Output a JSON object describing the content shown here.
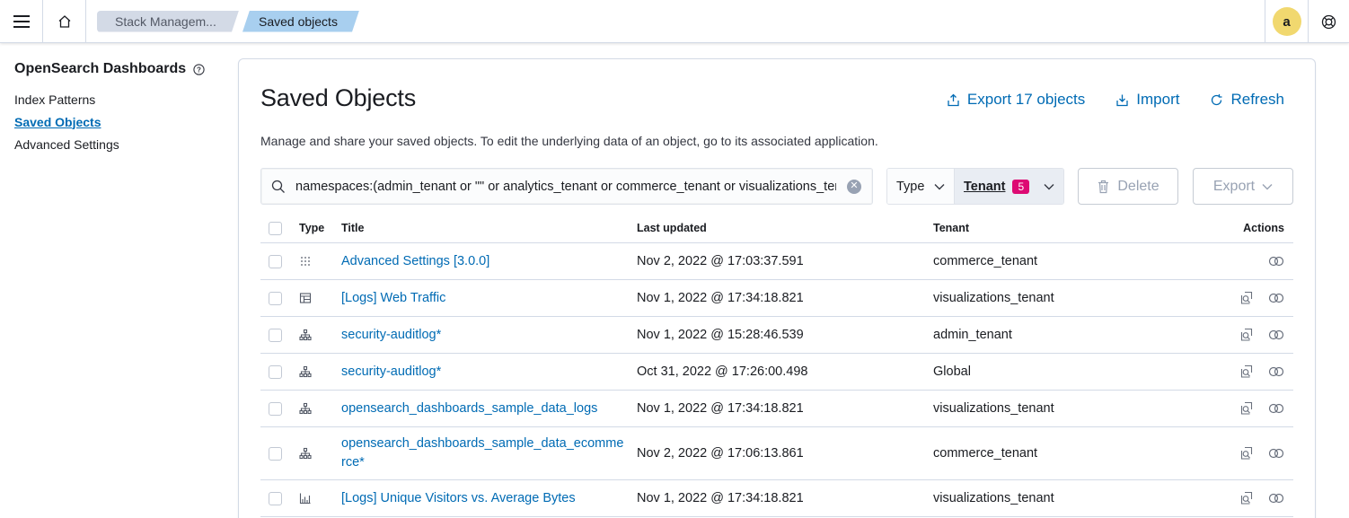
{
  "header": {
    "breadcrumbs": [
      "Stack Managem...",
      "Saved objects"
    ],
    "avatar_initial": "a"
  },
  "sidebar": {
    "title": "OpenSearch Dashboards",
    "items": [
      {
        "label": "Index Patterns",
        "active": false
      },
      {
        "label": "Saved Objects",
        "active": true
      },
      {
        "label": "Advanced Settings",
        "active": false
      }
    ]
  },
  "page": {
    "title": "Saved Objects",
    "actions": {
      "export": "Export 17 objects",
      "import": "Import",
      "refresh": "Refresh"
    },
    "description": "Manage and share your saved objects. To edit the underlying data of an object, go to its associated application."
  },
  "search": {
    "value": "namespaces:(admin_tenant or \"\" or analytics_tenant or commerce_tenant or visualizations_tenant)"
  },
  "filters": {
    "type_label": "Type",
    "tenant_label": "Tenant",
    "tenant_count": "5"
  },
  "buttons": {
    "delete": "Delete",
    "export": "Export"
  },
  "table": {
    "columns": {
      "type": "Type",
      "title": "Title",
      "last_updated": "Last updated",
      "tenant": "Tenant",
      "actions": "Actions"
    },
    "rows": [
      {
        "type_icon": "advanced-settings-icon",
        "title": "Advanced Settings [3.0.0]",
        "last_updated": "Nov 2, 2022 @ 17:03:37.591",
        "tenant": "commerce_tenant",
        "actions": [
          "relationships"
        ]
      },
      {
        "type_icon": "dashboard-icon",
        "title": "[Logs] Web Traffic",
        "last_updated": "Nov 1, 2022 @ 17:34:18.821",
        "tenant": "visualizations_tenant",
        "actions": [
          "inspect",
          "relationships"
        ]
      },
      {
        "type_icon": "index-pattern-icon",
        "title": "security-auditlog*",
        "last_updated": "Nov 1, 2022 @ 15:28:46.539",
        "tenant": "admin_tenant",
        "actions": [
          "inspect",
          "relationships"
        ]
      },
      {
        "type_icon": "index-pattern-icon",
        "title": "security-auditlog*",
        "last_updated": "Oct 31, 2022 @ 17:26:00.498",
        "tenant": "Global",
        "actions": [
          "inspect",
          "relationships"
        ]
      },
      {
        "type_icon": "index-pattern-icon",
        "title": "opensearch_dashboards_sample_data_logs",
        "last_updated": "Nov 1, 2022 @ 17:34:18.821",
        "tenant": "visualizations_tenant",
        "actions": [
          "inspect",
          "relationships"
        ]
      },
      {
        "type_icon": "index-pattern-icon",
        "title_line1": "opensearch_dashboards_sample_data_ecomme",
        "title_line2": "rce*",
        "last_updated": "Nov 2, 2022 @ 17:06:13.861",
        "tenant": "commerce_tenant",
        "actions": [
          "inspect",
          "relationships"
        ]
      },
      {
        "type_icon": "visualization-icon",
        "title": "[Logs] Unique Visitors vs. Average Bytes",
        "last_updated": "Nov 1, 2022 @ 17:34:18.821",
        "tenant": "visualizations_tenant",
        "actions": [
          "inspect",
          "relationships"
        ]
      }
    ]
  },
  "colors": {
    "link": "#006bb4",
    "badge": "#dd0a73",
    "avatar": "#f1d86f",
    "active_crumb": "#a8cfef"
  }
}
